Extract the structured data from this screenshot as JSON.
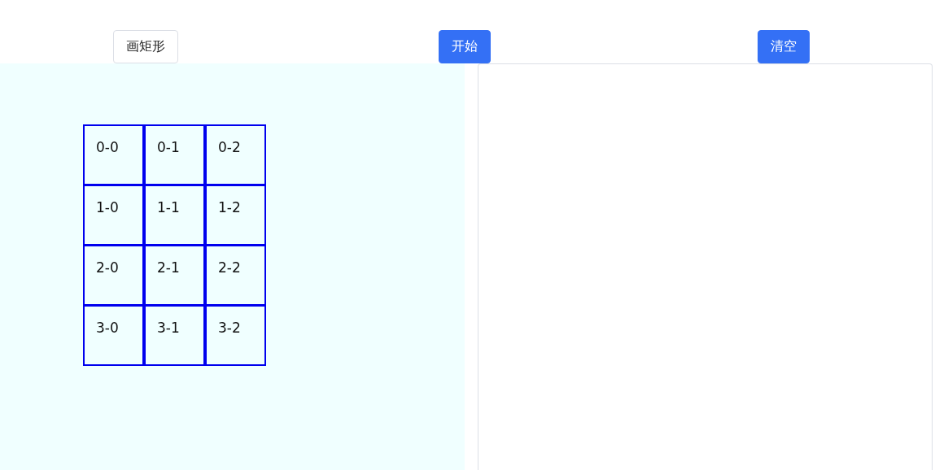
{
  "toolbar": [
    {
      "label": "画矩形",
      "kind": "default"
    },
    {
      "label": "开始",
      "kind": "primary"
    },
    {
      "label": "清空",
      "kind": "primary"
    }
  ],
  "grid": {
    "rows": [
      [
        "0-0",
        "0-1",
        "0-2"
      ],
      [
        "1-0",
        "1-1",
        "1-2"
      ],
      [
        "2-0",
        "2-1",
        "2-2"
      ],
      [
        "3-0",
        "3-1",
        "3-2"
      ]
    ]
  }
}
